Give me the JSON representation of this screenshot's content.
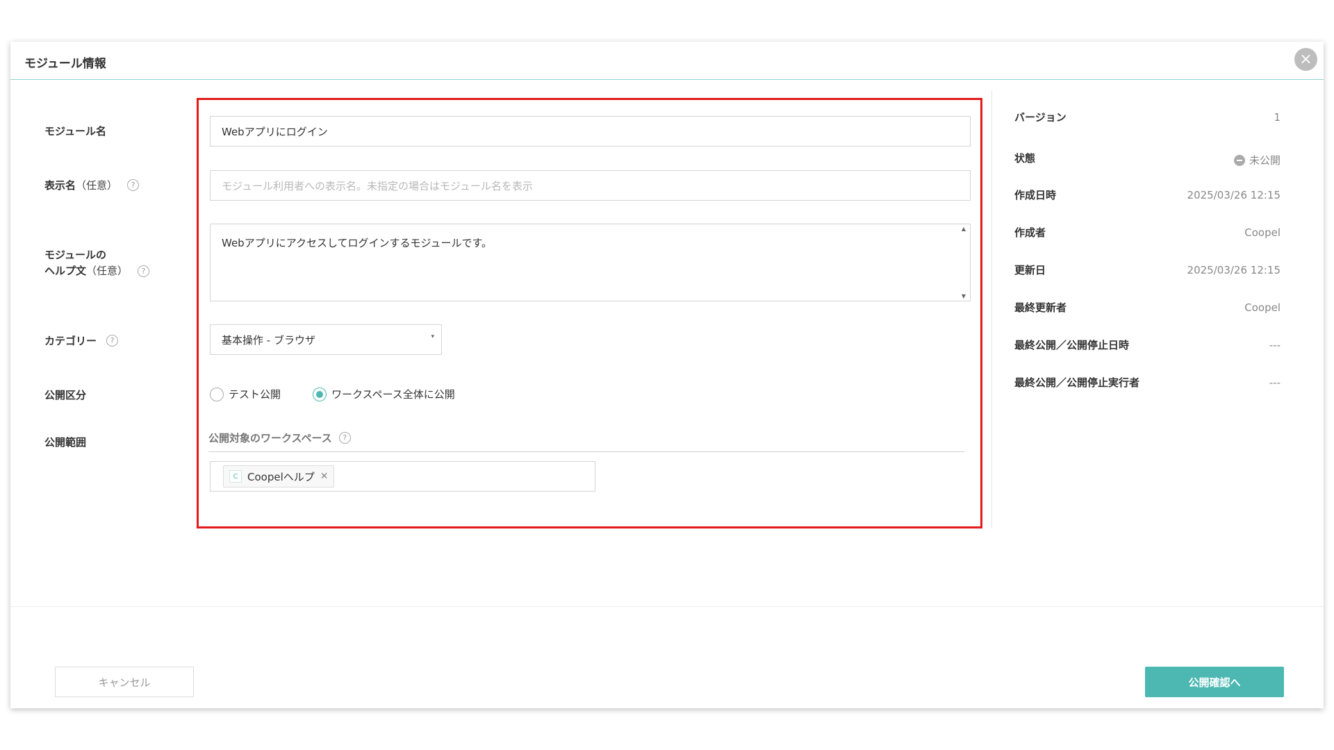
{
  "modal": {
    "title": "モジュール情報"
  },
  "form": {
    "module_name": {
      "label": "モジュール名",
      "value": "Webアプリにログイン"
    },
    "display_name": {
      "label": "表示名",
      "optional": "（任意）",
      "placeholder": "モジュール利用者への表示名。未指定の場合はモジュール名を表示"
    },
    "help_text": {
      "label_line1": "モジュールの",
      "label_line2": "ヘルプ文",
      "optional": "（任意）",
      "value": "Webアプリにアクセスしてログインするモジュールです。"
    },
    "category": {
      "label": "カテゴリー",
      "value": "基本操作 - ブラウザ"
    },
    "publish_type": {
      "label": "公開区分",
      "options": [
        "テスト公開",
        "ワークスペース全体に公開"
      ],
      "selected": "ワークスペース全体に公開"
    },
    "publish_scope": {
      "label": "公開範囲",
      "workspace_label": "公開対象のワークスペース",
      "tags": [
        {
          "icon_letter": "C",
          "name": "Coopelヘルプ"
        }
      ]
    }
  },
  "info": {
    "version": {
      "key": "バージョン",
      "value": "1"
    },
    "status": {
      "key": "状態",
      "value": "未公開"
    },
    "created_at": {
      "key": "作成日時",
      "value": "2025/03/26 12:15"
    },
    "created_by": {
      "key": "作成者",
      "value": "Coopel"
    },
    "updated_at": {
      "key": "更新日",
      "value": "2025/03/26 12:15"
    },
    "updated_by": {
      "key": "最終更新者",
      "value": "Coopel"
    },
    "last_publish_date": {
      "key": "最終公開／公開停止日時",
      "value": "---"
    },
    "last_publish_user": {
      "key": "最終公開／公開停止実行者",
      "value": "---"
    }
  },
  "footer": {
    "cancel_label": "キャンセル",
    "confirm_label": "公開確認へ"
  },
  "colors": {
    "accent": "#4db8b2",
    "highlight": "#e41a1a"
  }
}
